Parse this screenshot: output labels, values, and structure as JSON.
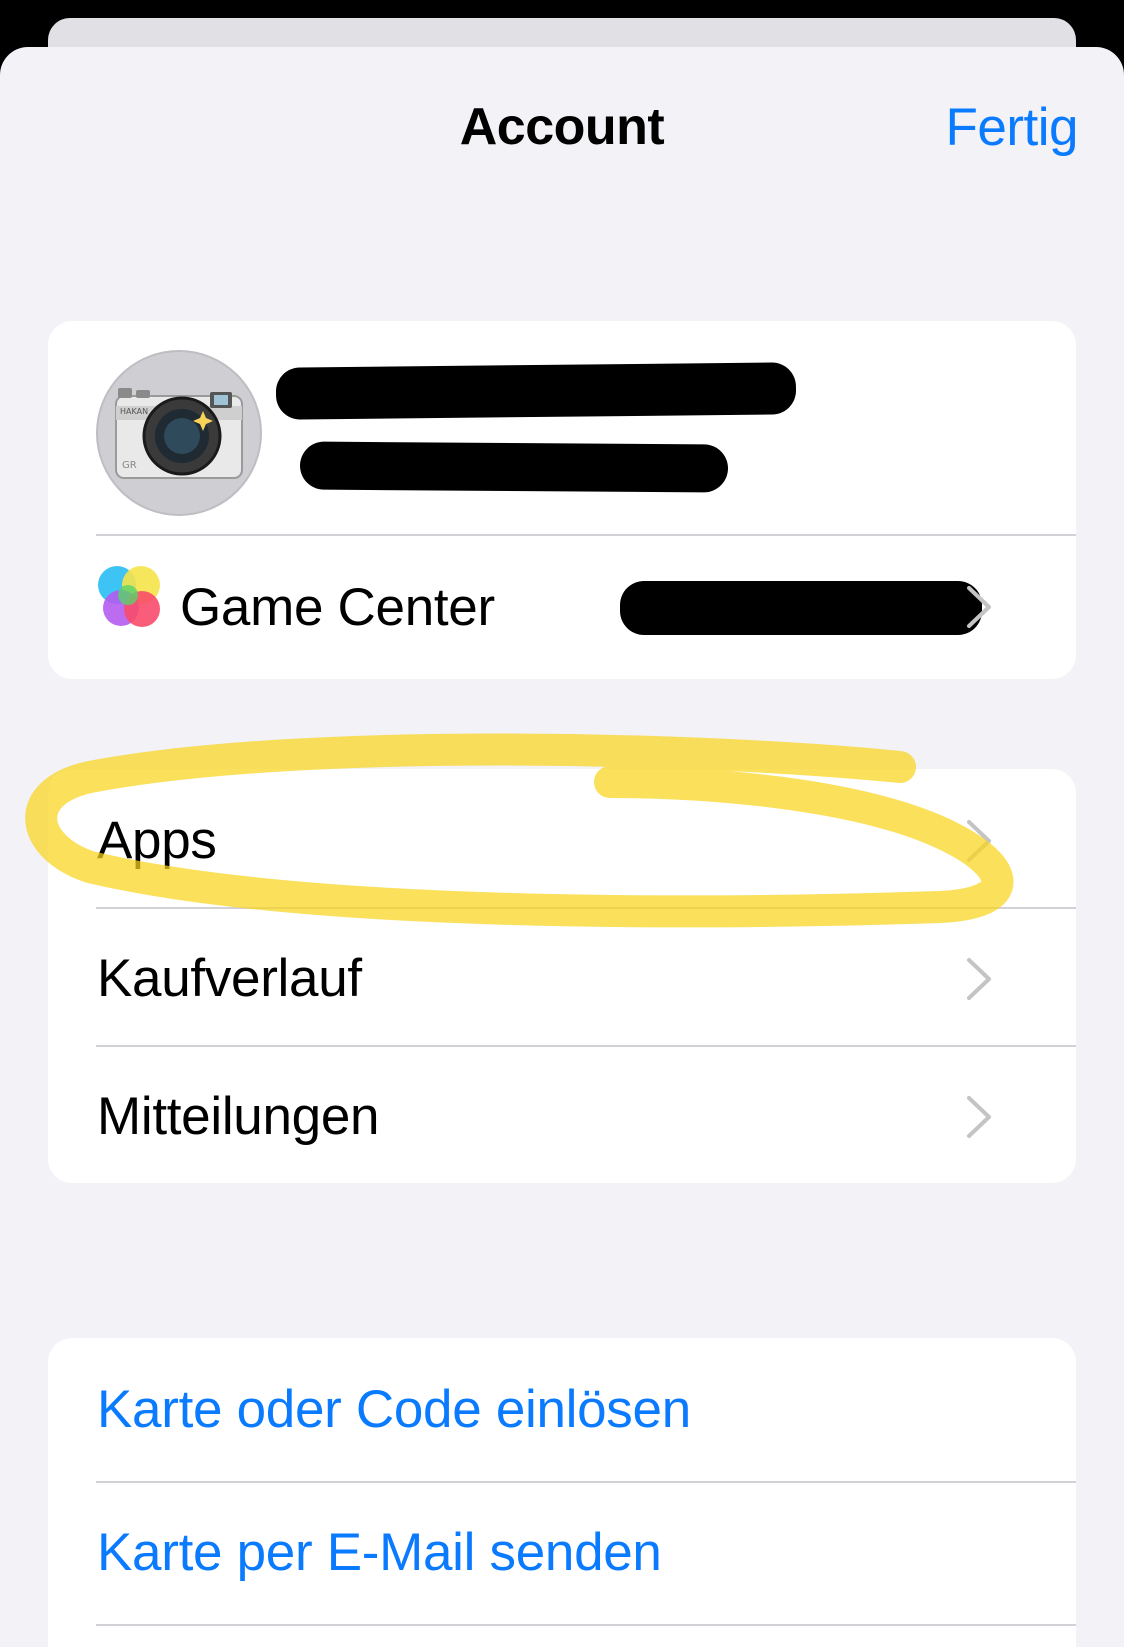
{
  "nav": {
    "title": "Account",
    "done_label": "Fertig"
  },
  "profile": {
    "avatar_text_top": "HAKAN",
    "avatar_text_bottom": "GR"
  },
  "game_center": {
    "label": "Game Center"
  },
  "menu": {
    "apps": "Apps",
    "purchases": "Kaufverlauf",
    "notifications": "Mitteilungen"
  },
  "actions": {
    "redeem": "Karte oder Code einlösen",
    "send_card": "Karte per E-Mail senden"
  },
  "colors": {
    "accent": "#0a7aff",
    "highlight": "#f8d41c",
    "background": "#f2f2f7"
  }
}
